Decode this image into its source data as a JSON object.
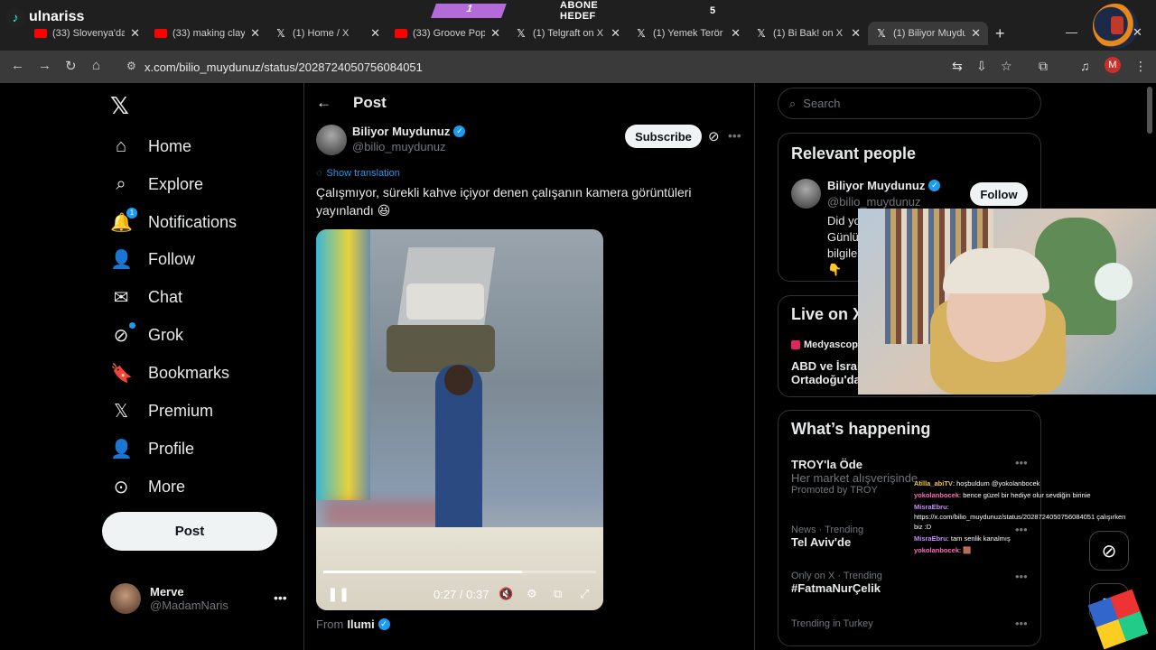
{
  "overlay": {
    "streamer_name": "ulnariss",
    "goal_current": "1",
    "goal_label": "ABONE HEDEF",
    "goal_target": "5"
  },
  "browser": {
    "tabs": [
      {
        "icon": "youtube",
        "title": "(33) Slovenya'da"
      },
      {
        "icon": "youtube",
        "title": "(33) making clay"
      },
      {
        "icon": "x",
        "title": "(1) Home / X"
      },
      {
        "icon": "youtube",
        "title": "(33) Groove Pop"
      },
      {
        "icon": "x",
        "title": "(1) Telgraft on X"
      },
      {
        "icon": "x",
        "title": "(1) Yemek Terör"
      },
      {
        "icon": "x",
        "title": "(1) Bi Bak! on X"
      },
      {
        "icon": "x",
        "title": "(1) Biliyor Muydu"
      }
    ],
    "active_tab": 7,
    "url": "x.com/bilio_muydunuz/status/2028724050756084051",
    "profile_initial": "M"
  },
  "sidebar": {
    "items": [
      {
        "label": "Home",
        "icon": "home-icon"
      },
      {
        "label": "Explore",
        "icon": "search-icon"
      },
      {
        "label": "Notifications",
        "icon": "bell-icon",
        "badge": "1"
      },
      {
        "label": "Follow",
        "icon": "person-plus-icon"
      },
      {
        "label": "Chat",
        "icon": "envelope-icon"
      },
      {
        "label": "Grok",
        "icon": "grok-icon"
      },
      {
        "label": "Bookmarks",
        "icon": "bookmark-icon"
      },
      {
        "label": "Premium",
        "icon": "x-logo-icon"
      },
      {
        "label": "Profile",
        "icon": "person-icon"
      },
      {
        "label": "More",
        "icon": "more-circle-icon"
      }
    ],
    "post_button": "Post",
    "user": {
      "name": "Merve",
      "handle": "@MadamNaris"
    }
  },
  "post": {
    "header": "Post",
    "author_name": "Biliyor Muydunuz",
    "author_handle": "@bilio_muydunuz",
    "subscribe_label": "Subscribe",
    "show_translation": "Show translation",
    "text": "Çalışmıyor, sürekli kahve içiyor denen çalışanın kamera görüntüleri yayınlandı 😆",
    "video_time": "0:27 / 0:37",
    "video_progress": 0.73,
    "from_label": "From",
    "from_source": "Ilumi"
  },
  "right": {
    "search_placeholder": "Search",
    "relevant_title": "Relevant people",
    "rp_name": "Biliyor Muydunuz",
    "rp_handle": "@bilio_muydunuz",
    "follow_label": "Follow",
    "rp_bio": "Did yo\nGünlü\nbilgiler\n👇",
    "live_title": "Live on X",
    "live_source": "Medyascop",
    "live_text1": "ABD ve İsrail",
    "live_text2": "Ortadoğu'da",
    "happening_title": "What’s happening",
    "trends": [
      {
        "meta": "",
        "name": "TROY'la Öde",
        "sub": "Her market alışverişinde...",
        "promo": "Promoted by TROY"
      },
      {
        "meta": "News · Trending",
        "name": "Tel Aviv'de"
      },
      {
        "meta": "Only on X · Trending",
        "name": "#FatmaNurÇelik"
      },
      {
        "meta": "Trending in Turkey",
        "name": ""
      }
    ]
  },
  "chat": [
    {
      "user": "Atilla_abiTV",
      "msg": "hoşbuldum @yokolanbocek"
    },
    {
      "user": "yokolanbocek",
      "msg": "bence güzel bir hediye olur sevdiğin birinie"
    },
    {
      "user": "MisraEbru",
      "msg": "https://x.com/bilio_muydunuz/status/2028724050756084051 çalışırken biz :D"
    },
    {
      "user": "MisraEbru",
      "msg": "tam senlik kanalmış"
    },
    {
      "user": "yokolanbocek",
      "msg": "🟫"
    }
  ],
  "colors": {
    "accent": "#1d9bf0",
    "background": "#000000",
    "chrome": "#3a3a3a",
    "goal": "#b26bd8"
  }
}
